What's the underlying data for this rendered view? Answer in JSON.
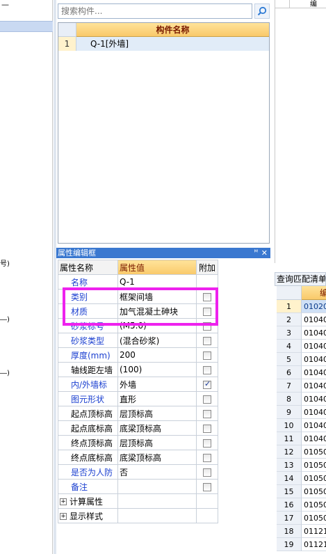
{
  "left_strip": {
    "header_glyph": "—",
    "edge_glyphs": [
      "号)",
      "―)",
      "―)"
    ]
  },
  "search": {
    "placeholder": "搜索构件...",
    "icon": "search-icon"
  },
  "component_list": {
    "column_header": "构件名称",
    "rows": [
      {
        "index": "1",
        "name": "Q-1[外墙]"
      }
    ]
  },
  "property_editor": {
    "title": "属性编辑框",
    "pin_icon": "pin-icon",
    "close_icon": "close-icon",
    "headers": {
      "name": "属性名称",
      "value": "属性值",
      "extra": "附加"
    },
    "rows": [
      {
        "name": "名称",
        "value": "Q-1"
      },
      {
        "name": "类别",
        "value": "框架间墙"
      },
      {
        "name": "材质",
        "value": "加气混凝土砷块"
      },
      {
        "name": "砂浆标号",
        "value": "(M5.0)"
      },
      {
        "name": "砂浆类型",
        "value": "(混合砂浆)"
      },
      {
        "name": "厚度(mm)",
        "value": "200"
      },
      {
        "name": "轴线距左墙",
        "value": "(100)"
      },
      {
        "name": "内/外墙标",
        "value": "外墙",
        "checked": true
      },
      {
        "name": "图元形状",
        "value": "直形"
      },
      {
        "name": "起点顶标高",
        "value": "层顶标高"
      },
      {
        "name": "起点底标高",
        "value": "底梁顶标高"
      },
      {
        "name": "终点顶标高",
        "value": "层顶标高"
      },
      {
        "name": "终点底标高",
        "value": "底梁顶标高"
      },
      {
        "name": "是否为人防",
        "value": "否"
      },
      {
        "name": "备注",
        "value": ""
      }
    ],
    "groups": [
      {
        "label": "计算属性"
      },
      {
        "label": "显示样式"
      }
    ],
    "expander_glyph": "+"
  },
  "right_top": {
    "header_text": "编"
  },
  "query_panel": {
    "title": "查询匹配清单",
    "column_header": "编",
    "rows": [
      {
        "index": "1",
        "code": "01020"
      },
      {
        "index": "2",
        "code": "01040"
      },
      {
        "index": "3",
        "code": "01040"
      },
      {
        "index": "4",
        "code": "01040"
      },
      {
        "index": "5",
        "code": "01040"
      },
      {
        "index": "6",
        "code": "01040"
      },
      {
        "index": "7",
        "code": "01040"
      },
      {
        "index": "8",
        "code": "01040"
      },
      {
        "index": "9",
        "code": "01040"
      },
      {
        "index": "10",
        "code": "01040"
      },
      {
        "index": "11",
        "code": "01040"
      },
      {
        "index": "12",
        "code": "01050"
      },
      {
        "index": "13",
        "code": "01050"
      },
      {
        "index": "14",
        "code": "01050"
      },
      {
        "index": "15",
        "code": "01050"
      },
      {
        "index": "16",
        "code": "01050"
      },
      {
        "index": "17",
        "code": "01050"
      },
      {
        "index": "18",
        "code": "01121"
      },
      {
        "index": "19",
        "code": "01121"
      }
    ]
  },
  "colors": {
    "highlight": "#ee22ee",
    "titlebar": "#3a78d0",
    "header_gold": "#f9c96a",
    "link_blue": "#1a3fd0"
  }
}
